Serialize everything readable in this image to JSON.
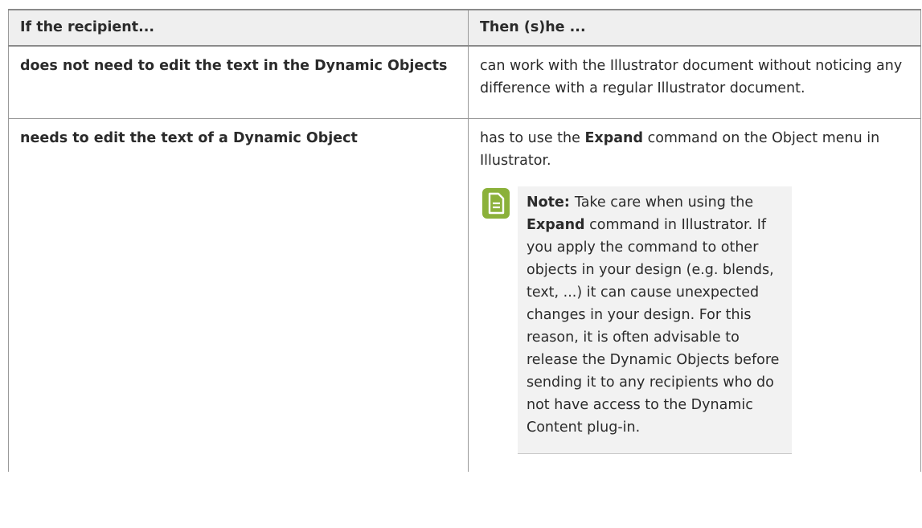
{
  "table": {
    "headers": [
      "If the recipient...",
      "Then (s)he ..."
    ],
    "rows": [
      {
        "condition": "does not need to edit the text in the Dynamic Objects",
        "result": "can work with the Illustrator document without noticing any difference with a regular Illustrator document."
      },
      {
        "condition": "needs to edit the text of a Dynamic Object",
        "result_pre": "has to use the ",
        "result_bold": "Expand",
        "result_post": " command on the Object menu in Illustrator."
      }
    ]
  },
  "note": {
    "label": "Note:",
    "text_pre": "Take care when using the ",
    "text_bold": "Expand",
    "text_post": " command in Illustrator. If you apply the command to other objects in your design (e.g. blends, text, ...) it can cause unexpected changes in your design. For this reason, it is often advisable to release the Dynamic Objects before sending it to any recipients who do not have access to the Dynamic Content plug-in.",
    "icon": "note-document-icon",
    "icon_color": "#8bb13a"
  }
}
